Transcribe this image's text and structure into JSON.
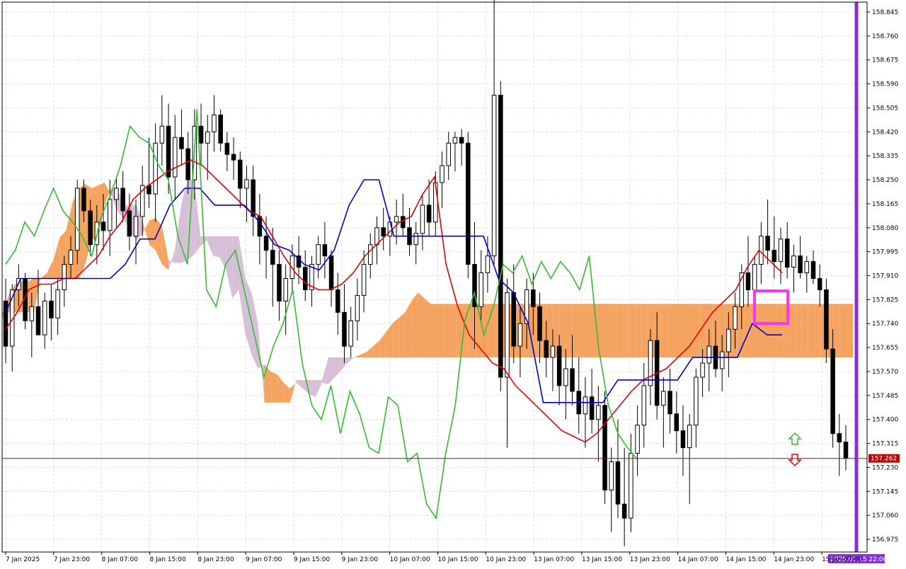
{
  "chart_data": {
    "type": "candlestick",
    "indicator": "Ichimoku Kinko Hyo",
    "ylim": [
      156.93,
      158.9
    ],
    "y_ticks": [
      "158.845",
      "158.760",
      "158.675",
      "158.590",
      "158.505",
      "158.420",
      "158.335",
      "158.250",
      "158.165",
      "158.080",
      "157.995",
      "157.910",
      "157.825",
      "157.740",
      "157.655",
      "157.570",
      "157.485",
      "157.400",
      "157.315",
      "157.230",
      "157.145",
      "157.060",
      "156.975"
    ],
    "x_ticks": [
      "7 Jan 2025",
      "7 Jan 23:00",
      "8 Jan 07:00",
      "8 Jan 15:00",
      "8 Jan 23:00",
      "9 Jan 07:00",
      "9 Jan 15:00",
      "9 Jan 23:00",
      "10 Jan 07:00",
      "10 Jan 15:00",
      "10 Jan 23:00",
      "13 Jan 07:00",
      "13 Jan 15:00",
      "13 Jan 23:00",
      "14 Jan 07:00",
      "14 Jan 15:00",
      "14 Jan 23:00",
      "15 Jan 07:00"
    ],
    "current_price": "157.262",
    "period_separator_label": "2025.01.15 22:00",
    "colors": {
      "bull_body": "#ffffff",
      "bear_body": "#000000",
      "tenkan": "#e00000",
      "kijun": "#0000cc",
      "chikou": "#33bb33",
      "kumo_bull": "#f4a460",
      "kumo_bear": "#d8bfd8",
      "current_price_line": "#c00000",
      "separator": "#8a2be2",
      "signal_box": "#ff33ff",
      "arrow_up": "#33bb33",
      "arrow_down": "#e00000"
    },
    "candles": [
      [
        157.82,
        157.9,
        157.6,
        157.66
      ],
      [
        157.66,
        157.88,
        157.57,
        157.86
      ],
      [
        157.86,
        157.95,
        157.8,
        157.9
      ],
      [
        157.9,
        157.92,
        157.72,
        157.75
      ],
      [
        157.75,
        157.85,
        157.62,
        157.8
      ],
      [
        157.8,
        157.93,
        157.7,
        157.7
      ],
      [
        157.7,
        157.85,
        157.65,
        157.82
      ],
      [
        157.82,
        157.88,
        157.68,
        157.76
      ],
      [
        157.76,
        157.9,
        157.7,
        157.86
      ],
      [
        157.86,
        157.98,
        157.8,
        157.95
      ],
      [
        157.95,
        158.05,
        157.9,
        158.0
      ],
      [
        158.0,
        158.25,
        157.95,
        158.22
      ],
      [
        158.22,
        158.25,
        158.1,
        158.14
      ],
      [
        158.14,
        158.18,
        157.98,
        158.02
      ],
      [
        158.02,
        158.16,
        157.95,
        158.1
      ],
      [
        158.1,
        158.2,
        158.0,
        158.07
      ],
      [
        158.07,
        158.25,
        157.98,
        158.18
      ],
      [
        158.18,
        158.26,
        158.08,
        158.22
      ],
      [
        158.22,
        158.28,
        158.1,
        158.14
      ],
      [
        158.14,
        158.2,
        158.0,
        158.05
      ],
      [
        158.05,
        158.18,
        157.95,
        158.12
      ],
      [
        158.12,
        158.3,
        158.05,
        158.23
      ],
      [
        158.23,
        158.4,
        158.15,
        158.2
      ],
      [
        158.2,
        158.45,
        158.1,
        158.38
      ],
      [
        158.38,
        158.55,
        158.3,
        158.44
      ],
      [
        158.44,
        158.52,
        158.2,
        158.26
      ],
      [
        158.26,
        158.48,
        158.18,
        158.4
      ],
      [
        158.4,
        158.5,
        158.3,
        158.36
      ],
      [
        158.36,
        158.42,
        158.2,
        158.25
      ],
      [
        158.25,
        158.5,
        158.18,
        158.44
      ],
      [
        158.44,
        158.52,
        158.3,
        158.38
      ],
      [
        158.38,
        158.48,
        158.25,
        158.42
      ],
      [
        158.42,
        158.55,
        158.35,
        158.48
      ],
      [
        158.48,
        158.5,
        158.35,
        158.38
      ],
      [
        158.38,
        158.42,
        158.28,
        158.34
      ],
      [
        158.34,
        158.4,
        158.25,
        158.32
      ],
      [
        158.32,
        158.35,
        158.15,
        158.22
      ],
      [
        158.22,
        158.3,
        158.1,
        158.25
      ],
      [
        158.25,
        158.3,
        158.05,
        158.12
      ],
      [
        158.12,
        158.2,
        157.95,
        158.05
      ],
      [
        158.05,
        158.12,
        157.9,
        158.0
      ],
      [
        158.0,
        158.08,
        157.8,
        157.95
      ],
      [
        157.95,
        158.0,
        157.75,
        157.82
      ],
      [
        157.82,
        157.95,
        157.7,
        157.9
      ],
      [
        157.9,
        158.02,
        157.85,
        157.98
      ],
      [
        157.98,
        158.05,
        157.88,
        157.94
      ],
      [
        157.94,
        158.0,
        157.82,
        157.86
      ],
      [
        157.86,
        157.98,
        157.8,
        157.95
      ],
      [
        157.95,
        158.05,
        157.9,
        158.02
      ],
      [
        158.02,
        158.1,
        157.9,
        157.98
      ],
      [
        157.98,
        158.0,
        157.8,
        157.86
      ],
      [
        157.86,
        157.92,
        157.7,
        157.78
      ],
      [
        157.78,
        157.88,
        157.6,
        157.66
      ],
      [
        157.66,
        157.8,
        157.62,
        157.75
      ],
      [
        157.75,
        157.9,
        157.68,
        157.84
      ],
      [
        157.84,
        158.0,
        157.78,
        157.95
      ],
      [
        157.95,
        158.06,
        157.9,
        158.02
      ],
      [
        158.02,
        158.12,
        157.95,
        158.08
      ],
      [
        158.08,
        158.15,
        158.0,
        158.05
      ],
      [
        158.05,
        158.12,
        157.98,
        158.1
      ],
      [
        158.1,
        158.18,
        158.02,
        158.12
      ],
      [
        158.12,
        158.2,
        158.05,
        158.08
      ],
      [
        158.08,
        158.15,
        157.98,
        158.02
      ],
      [
        158.02,
        158.1,
        157.95,
        158.06
      ],
      [
        158.06,
        158.2,
        158.0,
        158.16
      ],
      [
        158.16,
        158.25,
        158.05,
        158.1
      ],
      [
        158.1,
        158.28,
        158.05,
        158.24
      ],
      [
        158.24,
        158.35,
        158.15,
        158.3
      ],
      [
        158.3,
        158.42,
        158.25,
        158.38
      ],
      [
        158.38,
        158.42,
        158.28,
        158.4
      ],
      [
        158.4,
        158.43,
        158.3,
        158.38
      ],
      [
        158.38,
        158.42,
        157.9,
        157.95
      ],
      [
        157.95,
        158.1,
        157.65,
        157.8
      ],
      [
        157.8,
        158.0,
        157.75,
        157.92
      ],
      [
        157.92,
        158.05,
        157.85,
        157.98
      ],
      [
        157.98,
        158.9,
        157.95,
        158.55
      ],
      [
        158.55,
        158.6,
        157.5,
        157.55
      ],
      [
        157.55,
        157.9,
        157.3,
        157.85
      ],
      [
        157.85,
        157.95,
        157.6,
        157.66
      ],
      [
        157.66,
        157.8,
        157.55,
        157.74
      ],
      [
        157.74,
        157.9,
        157.65,
        157.86
      ],
      [
        157.86,
        157.92,
        157.7,
        157.8
      ],
      [
        157.8,
        157.85,
        157.6,
        157.68
      ],
      [
        157.68,
        157.75,
        157.55,
        157.62
      ],
      [
        157.62,
        157.72,
        157.5,
        157.66
      ],
      [
        157.66,
        157.7,
        157.45,
        157.52
      ],
      [
        157.52,
        157.65,
        157.4,
        157.58
      ],
      [
        157.58,
        157.7,
        157.45,
        157.5
      ],
      [
        157.5,
        157.62,
        157.35,
        157.42
      ],
      [
        157.42,
        157.55,
        157.3,
        157.48
      ],
      [
        157.48,
        157.58,
        157.35,
        157.4
      ],
      [
        157.4,
        157.52,
        157.25,
        157.45
      ],
      [
        157.45,
        157.5,
        157.1,
        157.15
      ],
      [
        157.15,
        157.3,
        157.0,
        157.25
      ],
      [
        157.25,
        157.4,
        157.05,
        157.1
      ],
      [
        157.1,
        157.3,
        156.95,
        157.05
      ],
      [
        157.05,
        157.35,
        157.0,
        157.28
      ],
      [
        157.28,
        157.45,
        157.2,
        157.38
      ],
      [
        157.38,
        157.6,
        157.3,
        157.52
      ],
      [
        157.52,
        157.72,
        157.45,
        157.68
      ],
      [
        157.68,
        157.78,
        157.4,
        157.45
      ],
      [
        157.45,
        157.55,
        157.3,
        157.5
      ],
      [
        157.5,
        157.58,
        157.35,
        157.42
      ],
      [
        157.42,
        157.5,
        157.28,
        157.36
      ],
      [
        157.36,
        157.45,
        157.2,
        157.3
      ],
      [
        157.3,
        157.42,
        157.1,
        157.38
      ],
      [
        157.38,
        157.58,
        157.3,
        157.55
      ],
      [
        157.55,
        157.65,
        157.48,
        157.6
      ],
      [
        157.6,
        157.72,
        157.5,
        157.66
      ],
      [
        157.66,
        157.75,
        157.55,
        157.58
      ],
      [
        157.58,
        157.7,
        157.5,
        157.64
      ],
      [
        157.64,
        157.78,
        157.55,
        157.72
      ],
      [
        157.72,
        157.85,
        157.65,
        157.8
      ],
      [
        157.8,
        157.95,
        157.72,
        157.92
      ],
      [
        157.92,
        158.05,
        157.8,
        157.86
      ],
      [
        157.86,
        157.98,
        157.78,
        157.95
      ],
      [
        157.95,
        158.1,
        157.88,
        158.05
      ],
      [
        158.05,
        158.18,
        157.95,
        158.0
      ],
      [
        158.0,
        158.12,
        157.9,
        157.96
      ],
      [
        157.96,
        158.08,
        157.88,
        158.04
      ],
      [
        158.04,
        158.1,
        157.9,
        157.94
      ],
      [
        157.94,
        158.02,
        157.85,
        157.98
      ],
      [
        157.98,
        158.05,
        157.9,
        157.92
      ],
      [
        157.92,
        157.98,
        157.85,
        157.96
      ],
      [
        157.96,
        158.0,
        157.88,
        157.9
      ],
      [
        157.9,
        157.95,
        157.8,
        157.86
      ],
      [
        157.86,
        157.9,
        157.6,
        157.65
      ],
      [
        157.65,
        157.72,
        157.3,
        157.35
      ],
      [
        157.35,
        157.42,
        157.2,
        157.32
      ],
      [
        157.32,
        157.38,
        157.22,
        157.262
      ]
    ],
    "tenkan": [
      157.72,
      157.78,
      157.86,
      157.88,
      157.88,
      157.9,
      157.9,
      157.94,
      157.98,
      158.05,
      158.1,
      158.18,
      158.22,
      158.25,
      158.28,
      158.3,
      158.32,
      158.3,
      158.26,
      158.22,
      158.18,
      158.14,
      158.12,
      158.05,
      157.98,
      157.92,
      157.88,
      157.86,
      157.86,
      157.88,
      157.92,
      157.98,
      158.02,
      158.06,
      158.1,
      158.12,
      158.2,
      158.26,
      157.95,
      157.8,
      157.7,
      157.65,
      157.6,
      157.58,
      157.52,
      157.48,
      157.44,
      157.4,
      157.36,
      157.34,
      157.32,
      157.35,
      157.4,
      157.45,
      157.5,
      157.54,
      157.56,
      157.58,
      157.62,
      157.66,
      157.72,
      157.78,
      157.82,
      157.86,
      157.94,
      158.0,
      157.96,
      157.92
    ],
    "kijun": [
      157.78,
      157.9,
      157.9,
      157.9,
      157.9,
      157.9,
      157.9,
      157.9,
      157.95,
      158.04,
      158.04,
      158.16,
      158.22,
      158.22,
      158.16,
      158.16,
      158.16,
      158.1,
      158.02,
      158.0,
      157.95,
      157.93,
      158.0,
      158.16,
      158.25,
      158.25,
      158.05,
      158.05,
      158.05,
      158.05,
      158.05,
      158.05,
      158.05,
      157.9,
      157.85,
      157.74,
      157.46,
      157.46,
      157.46,
      157.46,
      157.46,
      157.54,
      157.54,
      157.54,
      157.54,
      157.54,
      157.62,
      157.62,
      157.62,
      157.62,
      157.74,
      157.7,
      157.7
    ],
    "chikou": [
      157.95,
      158.0,
      158.1,
      158.05,
      158.14,
      158.22,
      158.14,
      158.1,
      158.05,
      157.98,
      158.12,
      158.2,
      158.3,
      158.44,
      158.4,
      158.38,
      158.3,
      158.25,
      158.05,
      157.95,
      158.5,
      157.86,
      157.8,
      157.95,
      158.0,
      157.85,
      157.7,
      157.55,
      157.66,
      157.74,
      157.86,
      157.6,
      157.45,
      157.4,
      157.52,
      157.35,
      157.5,
      157.42,
      157.3,
      157.28,
      157.48,
      157.45,
      157.25,
      157.28,
      157.1,
      157.05,
      157.28,
      157.45,
      157.75,
      157.85,
      157.7,
      157.8,
      157.95,
      157.92,
      157.98,
      157.88,
      157.96,
      157.9,
      157.96,
      157.92,
      157.86,
      157.98,
      157.65,
      157.45,
      157.35,
      157.3,
      157.26
    ]
  }
}
